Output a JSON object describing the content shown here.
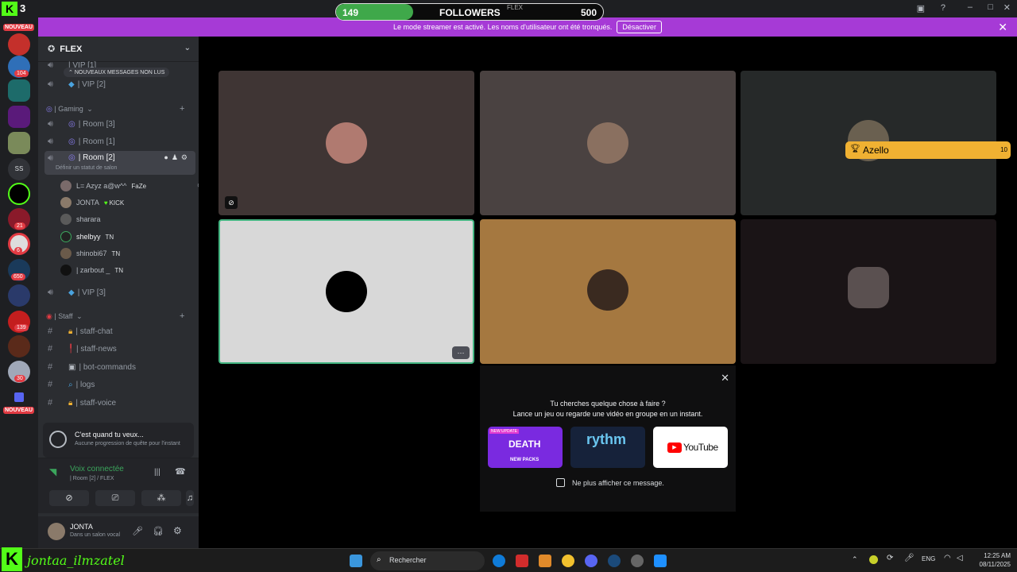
{
  "overlay": {
    "followers_current": "149",
    "followers_label": "FOLLOWERS",
    "followers_sublabel": "FLEX",
    "followers_goal": "500",
    "followers_progress_fraction": 0.29,
    "kick_badge_digit": "3",
    "streamer_handle": "jontaa_ilmzatel"
  },
  "banner": {
    "text": "Le mode streamer est activé. Les noms d'utilisateur ont été tronqués.",
    "button": "Désactiver"
  },
  "rail": {
    "nouveau_top": "NOUVEAU",
    "nouveau_bottom": "NOUVEAU",
    "badges": [
      "104",
      "21",
      "6",
      "650",
      "139",
      "30"
    ],
    "text_server": "SS"
  },
  "server": {
    "name": "FLEX",
    "new_messages": "NOUVEAUX MESSAGES NON LUS"
  },
  "channels": {
    "vip1": "| VIP [1]",
    "vip2": "| VIP [2]",
    "gaming_cat": "| Gaming",
    "room3": "| Room [3]",
    "room1": "| Room [1]",
    "room2": "| Room [2]",
    "room2_status": "Définir un statut de salon",
    "vip3": "| VIP [3]",
    "staff_cat": "| Staff",
    "staff_chat": "| staff-chat",
    "staff_news": "| staff-news",
    "bot_commands": "| bot-commands",
    "logs": "| logs",
    "staff_voice": "| staff-voice"
  },
  "members": [
    {
      "name": "L= Azyz a@w^^ ",
      "tag": "FaZe"
    },
    {
      "name": "JONTA",
      "tag": "KICK"
    },
    {
      "name": "sharara",
      "tag": ""
    },
    {
      "name": "shelbyy",
      "tag": "TN"
    },
    {
      "name": "shinobi67",
      "tag": "TN"
    },
    {
      "name": "| zarbout _ ",
      "tag": "TN"
    }
  ],
  "quest": {
    "title": "C'est quand tu veux...",
    "subtitle": "Aucune progression de quête pour l'instant"
  },
  "voice": {
    "status": "Voix connectée",
    "location": "| Room [2] / FLEX"
  },
  "user": {
    "name": "JONTA",
    "status": "Dans un salon vocal"
  },
  "stage": {
    "featured_name": "Azello",
    "featured_count": "10",
    "more_button": "···"
  },
  "popup": {
    "title": "Tu cherches quelque chose à faire ?",
    "subtitle": "Lance un jeu ou regarde une vidéo en groupe en un instant.",
    "card1_label": "NEW PACKS",
    "card1_badge": "NEW UPDATE",
    "card2_label": "rythm",
    "card3_label": "YouTube",
    "checkbox": "Ne plus afficher ce message."
  },
  "taskbar": {
    "search": "Rechercher",
    "lang": "ENG",
    "time": "12:25 AM",
    "date": "08/11/2025"
  },
  "colors": {
    "streamer_banner": "#a63ad6",
    "followers_fill": "#3fa84a",
    "featured_badge": "#f0b132",
    "active_tile_border": "#43b581"
  }
}
